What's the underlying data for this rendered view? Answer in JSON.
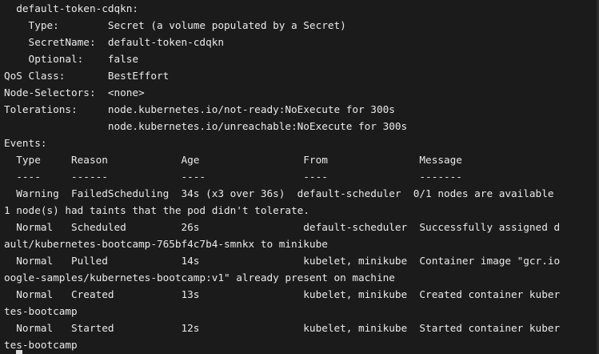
{
  "terminal": {
    "lines": [
      "  default-token-cdqkn:",
      "    Type:        Secret (a volume populated by a Secret)",
      "    SecretName:  default-token-cdqkn",
      "    Optional:    false",
      "QoS Class:       BestEffort",
      "Node-Selectors:  <none>",
      "Tolerations:     node.kubernetes.io/not-ready:NoExecute for 300s",
      "                 node.kubernetes.io/unreachable:NoExecute for 300s",
      "Events:",
      "  Type     Reason            Age                 From               Message",
      "  ----     ------            ----                ----               -------",
      "  Warning  FailedScheduling  34s (x3 over 36s)  default-scheduler  0/1 nodes are available",
      "1 node(s) had taints that the pod didn't tolerate.",
      "  Normal   Scheduled         26s                 default-scheduler  Successfully assigned d",
      "ault/kubernetes-bootcamp-765bf4c7b4-smnkx to minikube",
      "  Normal   Pulled            14s                 kubelet, minikube  Container image \"gcr.io",
      "oogle-samples/kubernetes-bootcamp:v1\" already present on machine",
      "  Normal   Created           13s                 kubelet, minikube  Created container kuber",
      "tes-bootcamp",
      "  Normal   Started           12s                 kubelet, minikube  Started container kuber",
      "tes-bootcamp"
    ],
    "colors": {
      "background": "#1b1b1b",
      "text": "#eaeaea",
      "cursor": "#d8d8d8"
    }
  }
}
